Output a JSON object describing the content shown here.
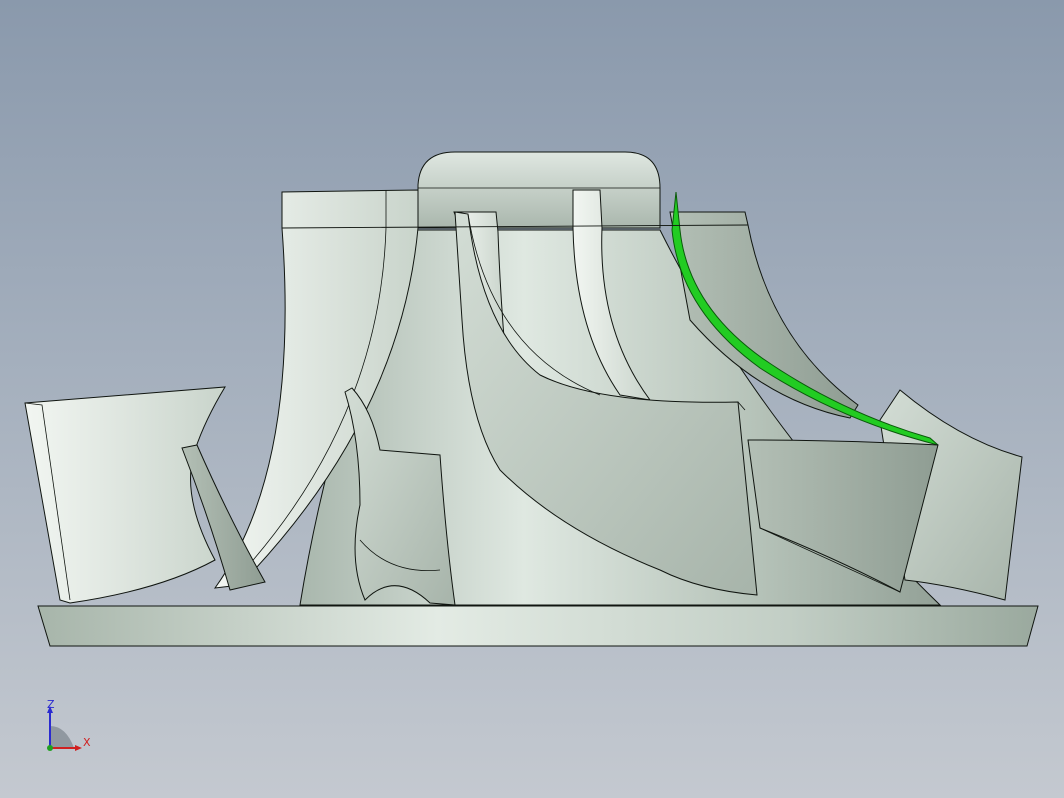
{
  "viewport": {
    "model": "impeller",
    "background_top": "#8a99ac",
    "background_bottom": "#c4c9d0",
    "part_color": "#c5d1c8",
    "edge_color": "#101510",
    "highlight_color": "#22cc22"
  },
  "triad": {
    "z_label": "Z",
    "x_label": "X",
    "z_color": "#2a2ad0",
    "x_color": "#d02020"
  }
}
